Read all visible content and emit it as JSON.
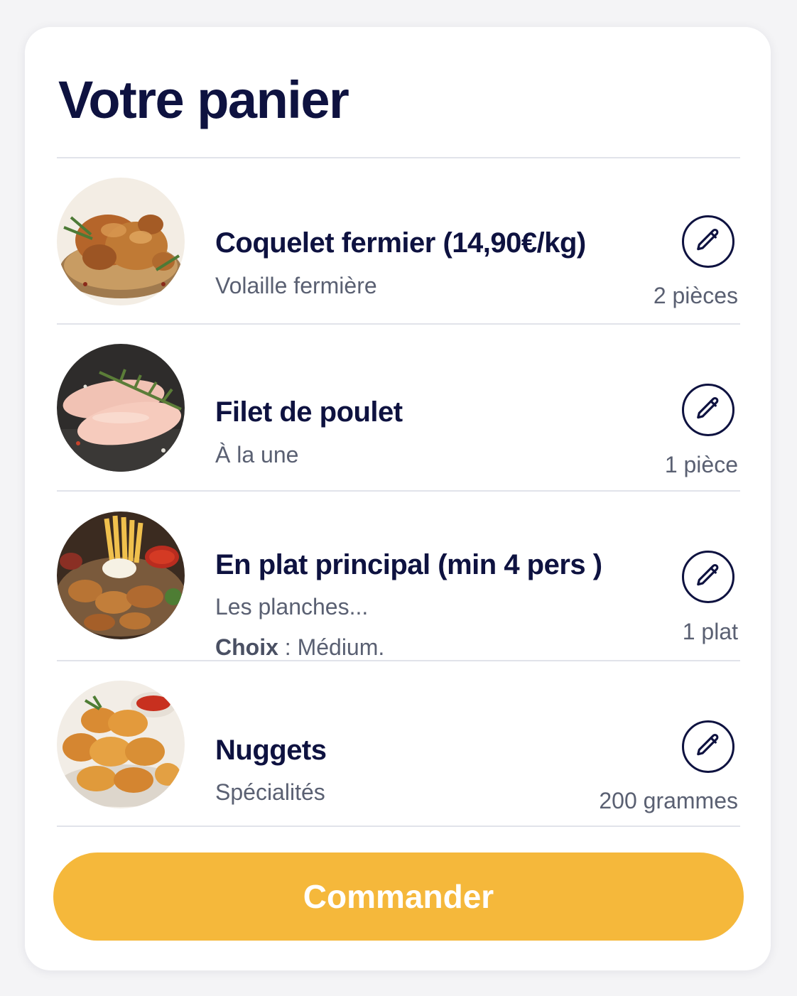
{
  "cart": {
    "title": "Votre panier",
    "items": [
      {
        "name": "Coquelet fermier (14,90€/kg)",
        "category": "Volaille fermière",
        "quantity": "2 pièces",
        "image": "roast-chicken-photo"
      },
      {
        "name": "Filet de poulet",
        "category": "À la une",
        "quantity": "1 pièce",
        "image": "raw-chicken-breast-photo"
      },
      {
        "name": "En plat principal (min 4 pers )",
        "category": "Les planches...",
        "choice_label": "Choix",
        "choice_separator": " : ",
        "choice_value": "Médium.",
        "quantity": "1 plat",
        "image": "platter-fries-wings-photo"
      },
      {
        "name": "Nuggets",
        "category": "Spécialités",
        "quantity": "200 grammes",
        "image": "nuggets-photo"
      }
    ],
    "edit_icon": "pencil-icon",
    "order_button": "Commander"
  },
  "colors": {
    "title": "#0e1240",
    "secondary_text": "#5a6072",
    "accent": "#f5b83b",
    "divider": "#e1e3ea"
  }
}
